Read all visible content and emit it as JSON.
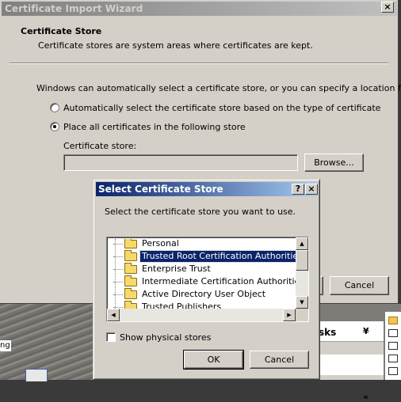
{
  "wizard": {
    "title": "Certificate Import Wizard",
    "close_glyph": "×",
    "heading": "Certificate Store",
    "subheading": "Certificate stores are system areas where certificates are kept.",
    "intro": "Windows can automatically select a certificate store, or you can specify a location for",
    "option_auto": "Automatically select the certificate store based on the type of certificate",
    "option_place": "Place all certificates in the following store",
    "store_label": "Certificate store:",
    "store_value": "",
    "browse_label": "Browse...",
    "cancel_label": "Cancel",
    "selected_option": "place"
  },
  "dialog": {
    "title": "Select Certificate Store",
    "help_glyph": "?",
    "close_glyph": "×",
    "instruction": "Select the certificate store you want to use.",
    "stores": [
      {
        "label": "Personal",
        "selected": false
      },
      {
        "label": "Trusted Root Certification Authorities",
        "selected": true
      },
      {
        "label": "Enterprise Trust",
        "selected": false
      },
      {
        "label": "Intermediate Certification Authorities",
        "selected": false
      },
      {
        "label": "Active Directory User Object",
        "selected": false
      },
      {
        "label": "Trusted Publishers",
        "selected": false
      }
    ],
    "show_physical_label": "Show physical stores",
    "show_physical_checked": false,
    "ok_label": "OK",
    "cancel_label": "Cancel",
    "scroll_up_glyph": "▲",
    "scroll_down_glyph": "▼",
    "scroll_left_glyph": "◀",
    "scroll_right_glyph": "▶"
  },
  "background": {
    "taskpane_title": "sks",
    "taskpane_chevron_down": "¥",
    "taskpane_chevron_up": "«",
    "desktop_text": "ng"
  },
  "colors": {
    "dialog_face": "#d4d0c8",
    "active_title": "#0a246a",
    "inactive_title": "#808080",
    "selection": "#0a246a"
  }
}
